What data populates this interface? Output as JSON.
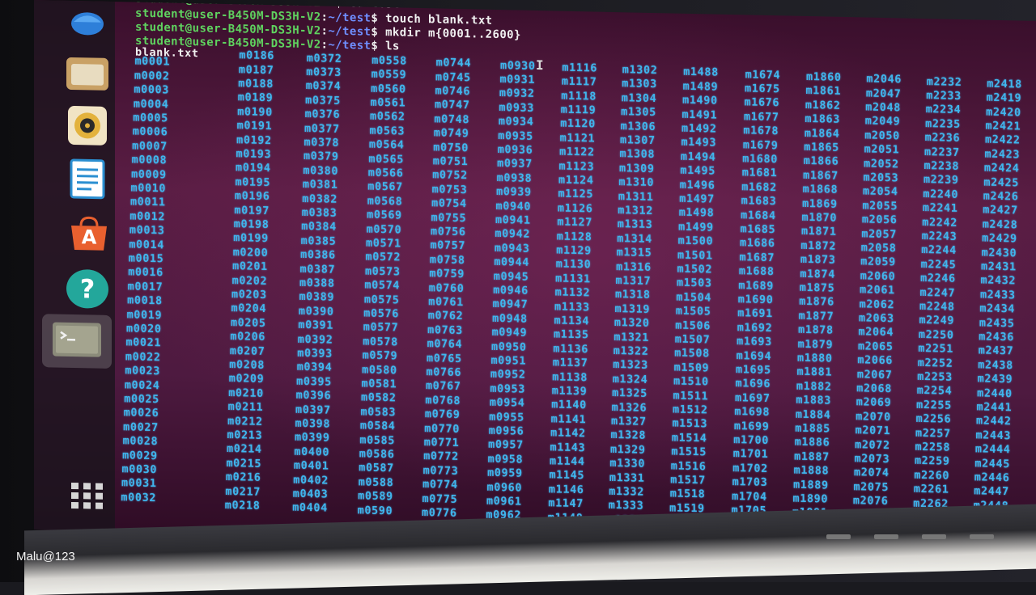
{
  "terminal": {
    "prompt_user": "student@user-B450M-DS3H-V2",
    "lines": [
      {
        "path": "~",
        "symbol": "$",
        "command": "cd test"
      },
      {
        "path": "~/test",
        "symbol": "$",
        "command": "touch blank.txt"
      },
      {
        "path": "~/test",
        "symbol": "$",
        "command": "mkdir m{0001..2600}"
      },
      {
        "path": "~/test",
        "symbol": "$",
        "command": "ls"
      }
    ],
    "cursor_glyph": "I",
    "ls_output": {
      "first_entry": "blank.txt",
      "columns": [
        {
          "start": 1,
          "count": 32
        },
        {
          "start": 186,
          "count": 33
        },
        {
          "start": 372,
          "count": 33
        },
        {
          "start": 558,
          "count": 33
        },
        {
          "start": 744,
          "count": 33
        },
        {
          "start": 930,
          "count": 33
        },
        {
          "start": 1116,
          "count": 33
        },
        {
          "start": 1302,
          "count": 33
        },
        {
          "start": 1488,
          "count": 33
        },
        {
          "start": 1674,
          "count": 33
        },
        {
          "start": 1860,
          "count": 33
        },
        {
          "start": 2046,
          "count": 33
        },
        {
          "start": 2232,
          "count": 33
        },
        {
          "start": 2418,
          "count": 33
        }
      ],
      "prefix": "m"
    }
  },
  "launcher": {
    "items": [
      {
        "name": "thunderbird-icon",
        "color": "#3a8ee6"
      },
      {
        "name": "files-icon",
        "color": "#c9a165"
      },
      {
        "name": "rhythmbox-icon",
        "color": "#e3b23c"
      },
      {
        "name": "libreoffice-writer-icon",
        "color": "#2b8fd1"
      },
      {
        "name": "software-center-icon",
        "color": "#e9602f"
      },
      {
        "name": "help-icon",
        "color": "#23a79b"
      },
      {
        "name": "terminal-icon",
        "color": "#8b8b7a"
      },
      {
        "name": "show-applications-icon",
        "color": "#d6d6d6"
      }
    ],
    "help_glyph": "?",
    "store_glyph": "A"
  },
  "photo_caption": "Malu@123"
}
